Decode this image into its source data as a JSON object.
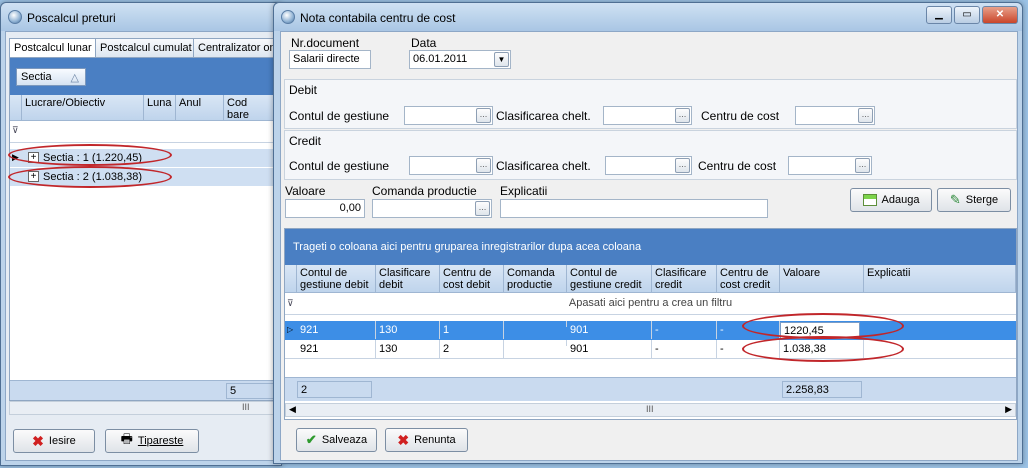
{
  "left_window": {
    "title": "Poscalcul preturi",
    "tabs": [
      "Postcalcul lunar",
      "Postcalcul cumulat",
      "Centralizator on"
    ],
    "group_chip": "Sectia",
    "columns": [
      "Lucrare/Obiectiv",
      "Luna",
      "Anul",
      "Cod bare"
    ],
    "groups": [
      "Sectia : 1 (1.220,45)",
      "Sectia : 2 (1.038,38)"
    ],
    "footer_count": "5",
    "buttons": {
      "exit": "Iesire",
      "print": "Tipareste"
    }
  },
  "dialog": {
    "title": "Nota contabila centru de cost",
    "nr_document_label": "Nr.document",
    "nr_document_value": "Salarii directe",
    "data_label": "Data",
    "data_value": "06.01.2011",
    "debit_label": "Debit",
    "credit_label": "Credit",
    "cont_gestiune_label": "Contul de gestiune",
    "clasificarea_label": "Clasificarea chelt.",
    "centru_cost_label": "Centru de cost",
    "valoare_label": "Valoare",
    "valoare_value": "0,00",
    "comanda_label": "Comanda productie",
    "explicatii_label": "Explicatii",
    "add_button": "Adauga",
    "delete_button": "Sterge",
    "group_panel_text": "Trageti o coloana aici pentru gruparea inregistrarilor dupa acea coloana",
    "columns": [
      "Contul de gestiune debit",
      "Clasificare debit",
      "Centru de cost debit",
      "Comanda productie",
      "Contul de gestiune credit",
      "Clasificare credit",
      "Centru de cost credit",
      "Valoare",
      "Explicatii"
    ],
    "filter_text": "Apasati aici pentru a crea un filtru",
    "rows": [
      [
        "921",
        "130",
        "1",
        "",
        "901",
        "-",
        "-",
        "1220,45",
        ""
      ],
      [
        "921",
        "130",
        "2",
        "",
        "901",
        "-",
        "-",
        "1.038,38",
        ""
      ]
    ],
    "footer_count": "2",
    "footer_total": "2.258,83",
    "save_button": "Salveaza",
    "cancel_button": "Renunta"
  },
  "colors": {
    "selected_row": "#3d8ee6",
    "grid_header_band": "#4a7fc3",
    "annotation": "#c1262a"
  }
}
